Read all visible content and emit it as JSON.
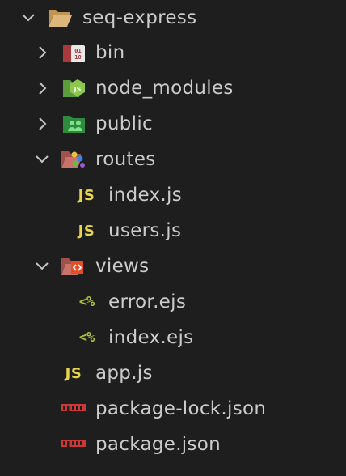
{
  "explorer": {
    "root": {
      "label": "seq-express",
      "icon": "folder-open-icon",
      "expanded": true
    },
    "items": [
      {
        "label": "bin",
        "icon": "folder-bin-icon",
        "expanded": false
      },
      {
        "label": "node_modules",
        "icon": "folder-node-icon",
        "expanded": false
      },
      {
        "label": "public",
        "icon": "folder-public-icon",
        "expanded": false
      },
      {
        "label": "routes",
        "icon": "folder-routes-icon",
        "expanded": true
      },
      {
        "label": "index.js",
        "icon": "js-file-icon",
        "icon_text": "JS"
      },
      {
        "label": "users.js",
        "icon": "js-file-icon",
        "icon_text": "JS"
      },
      {
        "label": "views",
        "icon": "folder-views-icon",
        "expanded": true
      },
      {
        "label": "error.ejs",
        "icon": "ejs-file-icon",
        "icon_text": "<%"
      },
      {
        "label": "index.ejs",
        "icon": "ejs-file-icon",
        "icon_text": "<%"
      },
      {
        "label": "app.js",
        "icon": "js-file-icon",
        "icon_text": "JS"
      },
      {
        "label": "package-lock.json",
        "icon": "npm-file-icon"
      },
      {
        "label": "package.json",
        "icon": "npm-file-icon"
      }
    ]
  },
  "colors": {
    "background": "#1e1e1e",
    "text": "#cccccc",
    "js": "#e8d44d",
    "ejs": "#a8c23a",
    "npm": "#cb3837",
    "folder": "#c09553"
  }
}
